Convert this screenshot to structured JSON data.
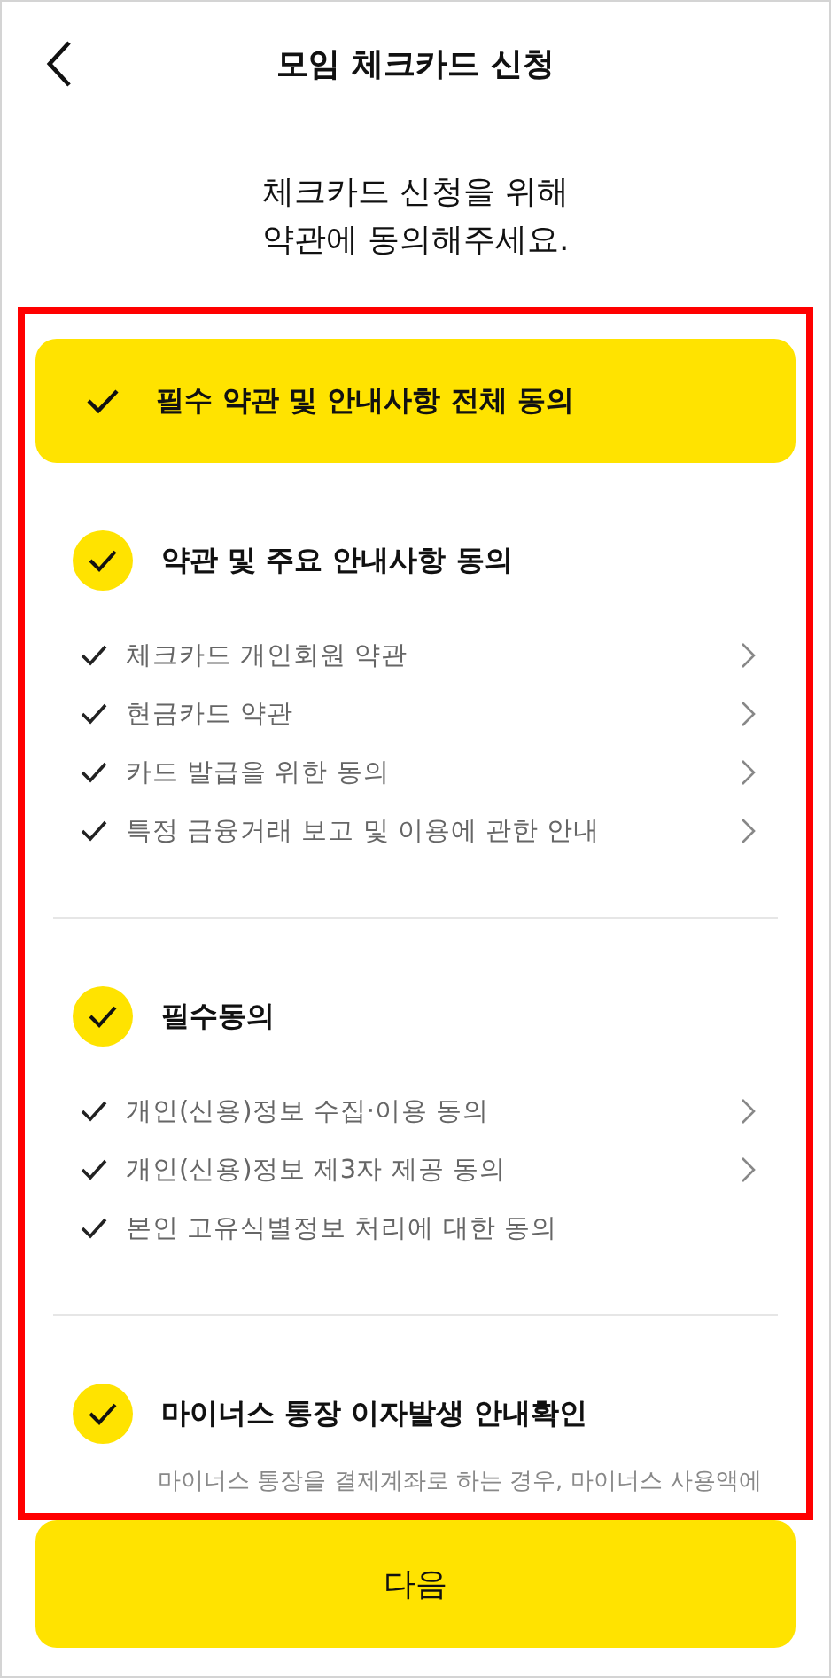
{
  "header": {
    "title": "모임 체크카드 신청"
  },
  "intro": [
    "체크카드 신청을 위해",
    "약관에 동의해주세요."
  ],
  "agree_all": {
    "label": "필수 약관 및 안내사항 전체 동의",
    "checked": true
  },
  "sections": [
    {
      "title": "약관 및 주요 안내사항 동의",
      "checked": true,
      "items": [
        {
          "label": "체크카드 개인회원 약관",
          "checked": true,
          "detail": true
        },
        {
          "label": "현금카드 약관",
          "checked": true,
          "detail": true
        },
        {
          "label": "카드 발급을 위한 동의",
          "checked": true,
          "detail": true
        },
        {
          "label": "특정 금융거래 보고 및 이용에 관한 안내",
          "checked": true,
          "detail": true
        }
      ]
    },
    {
      "title": "필수동의",
      "checked": true,
      "items": [
        {
          "label": "개인(신용)정보 수집·이용 동의",
          "checked": true,
          "detail": true
        },
        {
          "label": "개인(신용)정보 제3자 제공 동의",
          "checked": true,
          "detail": true
        },
        {
          "label": "본인 고유식별정보 처리에 대한 동의",
          "checked": true,
          "detail": false
        }
      ]
    },
    {
      "title": "마이너스 통장 이자발생 안내확인",
      "checked": true,
      "note": "마이너스 통장을 결제계좌로 하는 경우, 마이너스 사용액에"
    }
  ],
  "next_button": "다음"
}
